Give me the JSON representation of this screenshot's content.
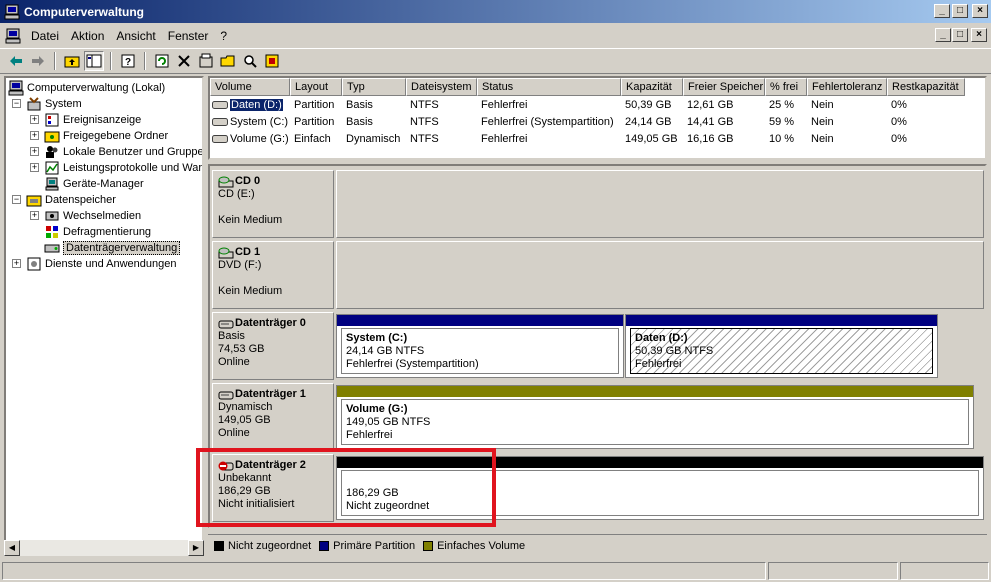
{
  "window": {
    "title": "Computerverwaltung",
    "controls": [
      "_",
      "□",
      "×"
    ]
  },
  "menu": {
    "items": [
      "Datei",
      "Aktion",
      "Ansicht",
      "Fenster",
      "?"
    ]
  },
  "tree": {
    "root": "Computerverwaltung (Lokal)",
    "system": "System",
    "system_items": [
      "Ereignisanzeige",
      "Freigegebene Ordner",
      "Lokale Benutzer und Gruppen",
      "Leistungsprotokolle und Warnungen",
      "Geräte-Manager"
    ],
    "storage": "Datenspeicher",
    "storage_items": [
      "Wechselmedien",
      "Defragmentierung",
      "Datenträgerverwaltung"
    ],
    "services": "Dienste und Anwendungen"
  },
  "volume_list": {
    "columns": [
      "Volume",
      "Layout",
      "Typ",
      "Dateisystem",
      "Status",
      "Kapazität",
      "Freier Speicher",
      "% frei",
      "Fehlertoleranz",
      "Restkapazität"
    ],
    "rows": [
      [
        "Daten (D:)",
        "Partition",
        "Basis",
        "NTFS",
        "Fehlerfrei",
        "50,39 GB",
        "12,61 GB",
        "25 %",
        "Nein",
        "0%"
      ],
      [
        "System (C:)",
        "Partition",
        "Basis",
        "NTFS",
        "Fehlerfrei (Systempartition)",
        "24,14 GB",
        "14,41 GB",
        "59 %",
        "Nein",
        "0%"
      ],
      [
        "Volume (G:)",
        "Einfach",
        "Dynamisch",
        "NTFS",
        "Fehlerfrei",
        "149,05 GB",
        "16,16 GB",
        "10 %",
        "Nein",
        "0%"
      ]
    ]
  },
  "disks": {
    "cd0": {
      "name": "CD 0",
      "line1": "CD (E:)",
      "line2": "",
      "line3": "Kein Medium"
    },
    "cd1": {
      "name": "CD 1",
      "line1": "DVD (F:)",
      "line2": "",
      "line3": "Kein Medium"
    },
    "disk0": {
      "name": "Datenträger 0",
      "line1": "Basis",
      "line2": "74,53 GB",
      "line3": "Online",
      "p1": {
        "title": "System  (C:)",
        "size": "24,14 GB NTFS",
        "status": "Fehlerfrei (Systempartition)"
      },
      "p2": {
        "title": "Daten  (D:)",
        "size": "50,39 GB NTFS",
        "status": "Fehlerfrei"
      }
    },
    "disk1": {
      "name": "Datenträger 1",
      "line1": "Dynamisch",
      "line2": "149,05 GB",
      "line3": "Online",
      "p1": {
        "title": "Volume  (G:)",
        "size": "149,05 GB NTFS",
        "status": "Fehlerfrei"
      }
    },
    "disk2": {
      "name": "Datenträger 2",
      "line1": "Unbekannt",
      "line2": "186,29 GB",
      "line3": "Nicht initialisiert",
      "p1": {
        "size": "186,29 GB",
        "status": "Nicht zugeordnet"
      }
    }
  },
  "legend": [
    {
      "label": "Nicht zugeordnet",
      "color": "#000000"
    },
    {
      "label": "Primäre Partition",
      "color": "#000080"
    },
    {
      "label": "Einfaches Volume",
      "color": "#808000"
    }
  ],
  "colors": {
    "primary": "#000080",
    "simple": "#808000",
    "unallocated": "#000000",
    "highlight": "#e0141e"
  }
}
